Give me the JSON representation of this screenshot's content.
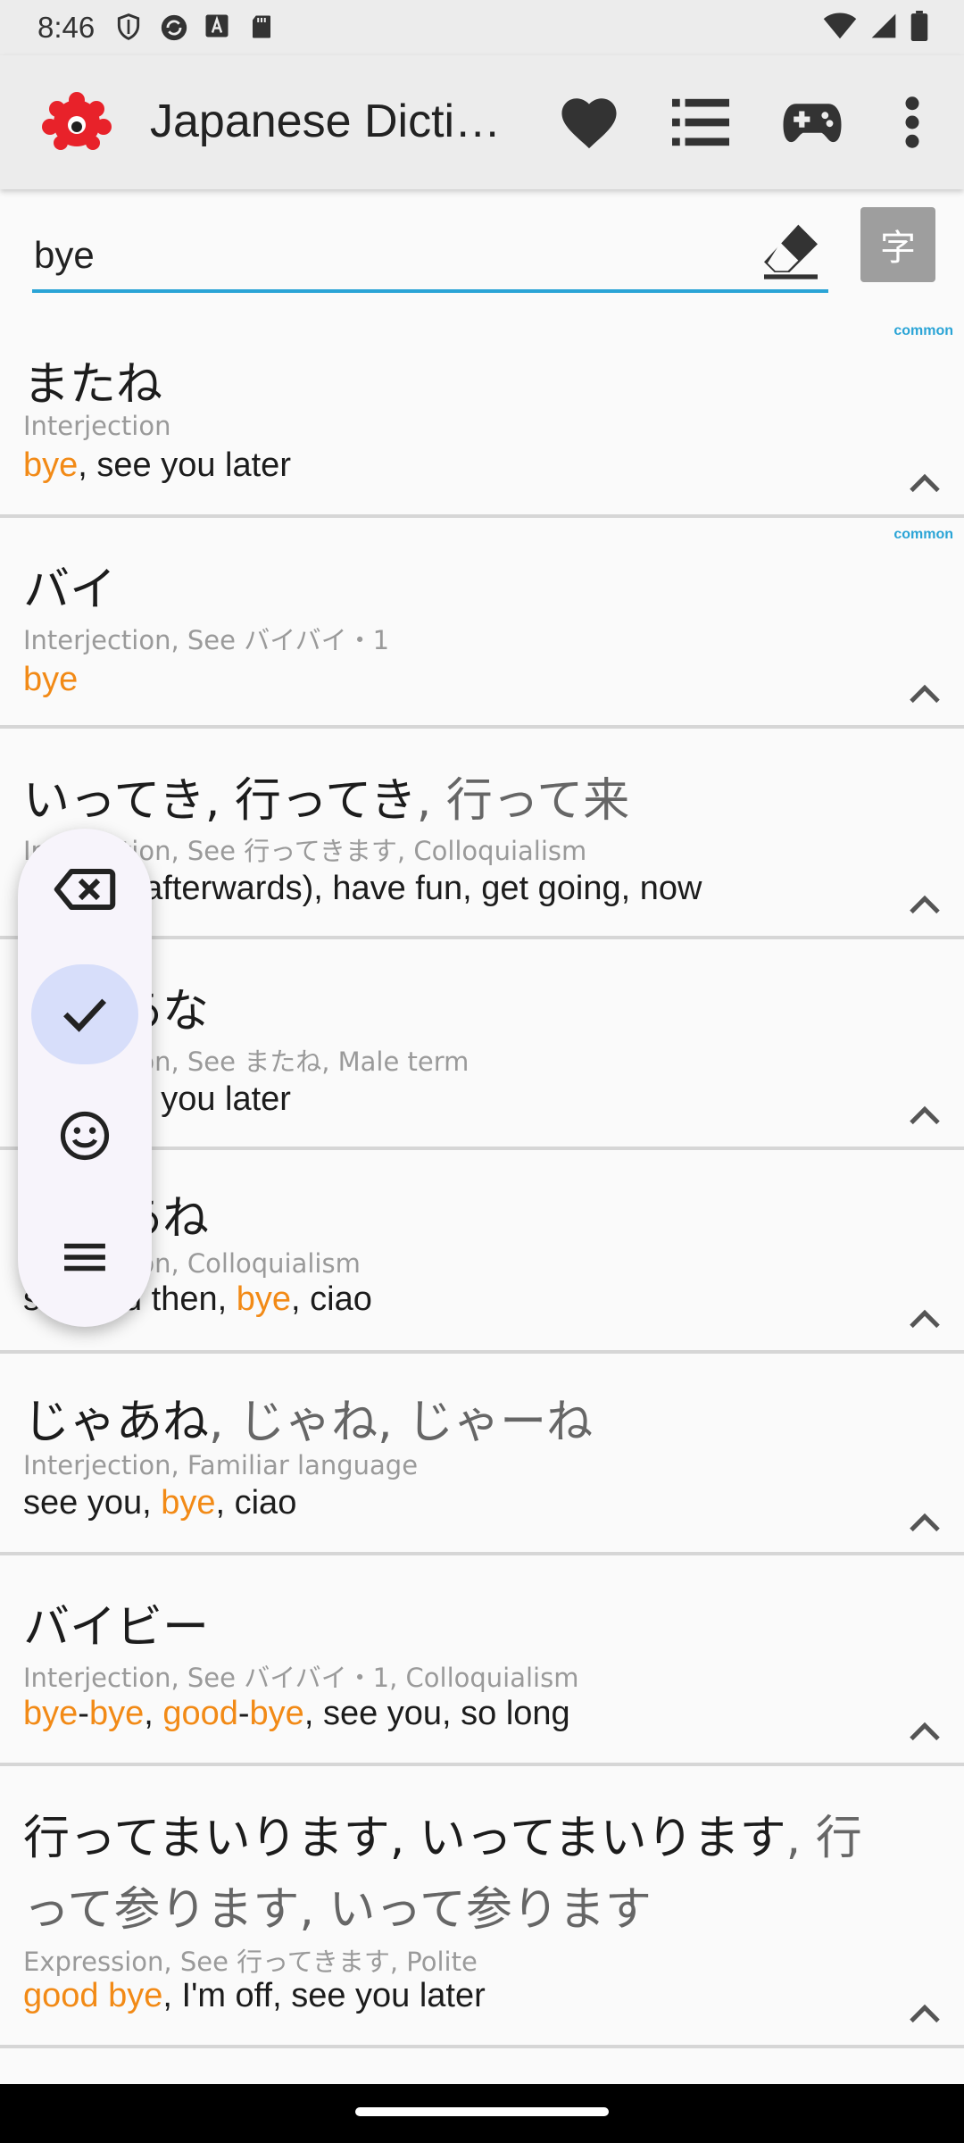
{
  "status_bar": {
    "time": "8:46"
  },
  "app_bar": {
    "title": "Japanese Dicti…",
    "icons": [
      "heart-icon",
      "list-icon",
      "gamepad-icon",
      "more-vert-icon"
    ]
  },
  "search": {
    "value": "bye",
    "kanji_button_label": "字"
  },
  "results": [
    {
      "common": "common",
      "word": "またね",
      "word_alt": "",
      "pos": "Interjection",
      "meaning": [
        {
          "t": "bye",
          "h": true
        },
        {
          "t": ", see you later",
          "h": false
        }
      ]
    },
    {
      "common": "common",
      "word": "バイ",
      "word_alt": "",
      "pos": "Interjection, See バイバイ・1",
      "meaning": [
        {
          "t": "bye",
          "h": true
        }
      ]
    },
    {
      "common": "",
      "word": "いってき, 行ってき",
      "word_alt": ", 行って来",
      "pos": "Interjection, See 行ってきます, Colloquialism",
      "meaning": [
        {
          "t": "see ya (afterwards), have fun, get going, now",
          "h": false
        }
      ]
    },
    {
      "common": "",
      "word": "じゃあな",
      "word_alt": "",
      "pos": "Interjection, See またね, Male term",
      "meaning": [
        {
          "t": "bye, see you later",
          "h": false
        }
      ]
    },
    {
      "common": "",
      "word": "じゃあね",
      "word_alt": "",
      "pos": "Interjection, Colloquialism",
      "meaning": [
        {
          "t": "see you then, ",
          "h": false
        },
        {
          "t": "bye",
          "h": true
        },
        {
          "t": ", ciao",
          "h": false
        }
      ]
    },
    {
      "common": "",
      "word": "じゃあね",
      "word_alt": ", じゃね, じゃーね",
      "pos": "Interjection, Familiar language",
      "meaning": [
        {
          "t": "see you, ",
          "h": false
        },
        {
          "t": "bye",
          "h": true
        },
        {
          "t": ", ciao",
          "h": false
        }
      ]
    },
    {
      "common": "",
      "word": "バイビー",
      "word_alt": "",
      "pos": "Interjection, See バイバイ・1, Colloquialism",
      "meaning": [
        {
          "t": "bye",
          "h": true
        },
        {
          "t": "-",
          "h": false
        },
        {
          "t": "bye",
          "h": true
        },
        {
          "t": ", ",
          "h": false
        },
        {
          "t": "good",
          "h": true
        },
        {
          "t": "-",
          "h": false
        },
        {
          "t": "bye",
          "h": true
        },
        {
          "t": ", see you, so long",
          "h": false
        }
      ]
    },
    {
      "common": "",
      "word": "行ってまいります, いってまいります",
      "word_alt": ", 行",
      "word_line2": "って参ります, いって参ります",
      "pos": "Expression, See 行ってきます, Polite",
      "meaning": [
        {
          "t": "good",
          "h": true
        },
        {
          "t": " ",
          "h": false
        },
        {
          "t": "bye",
          "h": true
        },
        {
          "t": ", I'm off, see you later",
          "h": false
        }
      ]
    }
  ],
  "floating_toolbar": {
    "buttons": [
      "backspace-icon",
      "check-icon",
      "emoji-icon",
      "menu-icon"
    ],
    "active_index": 1
  },
  "colors": {
    "accent": "#2aa4d6",
    "highlight": "#f28a16",
    "logo": "#e8222a"
  }
}
